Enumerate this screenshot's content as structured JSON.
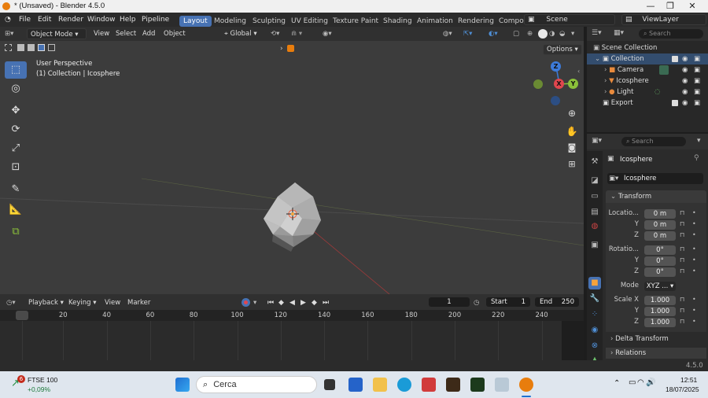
{
  "window": {
    "title": "* (Unsaved) - Blender 4.5.0"
  },
  "menu": [
    "File",
    "Edit",
    "Render",
    "Window",
    "Help",
    "Pipeline"
  ],
  "workspaces": [
    "Layout",
    "Modeling",
    "Sculpting",
    "UV Editing",
    "Texture Paint",
    "Shading",
    "Animation",
    "Rendering",
    "Compo"
  ],
  "active_workspace": "Layout",
  "scene_label": "Scene",
  "viewlayer_label": "ViewLayer",
  "viewport_header": {
    "mode": "Object Mode",
    "view": "View",
    "select": "Select",
    "add": "Add",
    "object": "Object",
    "orientation": "Global",
    "options": "Options"
  },
  "viewport_overlay": {
    "line1": "User Perspective",
    "line2": "(1) Collection | Icosphere"
  },
  "gizmo": {
    "x": "X",
    "y": "Y",
    "z": "Z"
  },
  "outliner": {
    "search_placeholder": "Search",
    "rows": [
      "Scene Collection",
      "Collection",
      "Camera",
      "Icosphere",
      "Light",
      "Export"
    ]
  },
  "properties": {
    "search_placeholder": "Search",
    "object_name": "Icosphere",
    "data_name": "Icosphere",
    "transform_label": "Transform",
    "location_label": "Locatio...",
    "loc": [
      "0 m",
      "0 m",
      "0 m"
    ],
    "rotation_label": "Rotatio...",
    "rot": [
      "0°",
      "0°",
      "0°"
    ],
    "axis_y": "Y",
    "axis_z": "Z",
    "mode_label": "Mode",
    "mode_value": "XYZ ...",
    "scale_label": "Scale X",
    "scale": [
      "1.000",
      "1.000",
      "1.000"
    ],
    "delta_label": "Delta Transform",
    "relations_label": "Relations"
  },
  "timeline": {
    "playback": "Playback",
    "keying": "Keying",
    "view": "View",
    "marker": "Marker",
    "current_frame": "1",
    "start_label": "Start",
    "start": "1",
    "end_label": "End",
    "end": "250",
    "ticks": [
      "1",
      "20",
      "40",
      "60",
      "80",
      "100",
      "120",
      "140",
      "160",
      "180",
      "200",
      "220",
      "240"
    ]
  },
  "status": {
    "version": "4.5.0"
  },
  "taskbar": {
    "ticker": "FTSE 100",
    "ticker_change": "+0,09%",
    "badge": "6",
    "search_placeholder": "Cerca",
    "time": "12:51",
    "date": "18/07/2025"
  },
  "colors": {
    "accent": "#4772b3",
    "viewport": "#3c3c3c",
    "x_axis": "#e0464e",
    "y_axis": "#8bc13a",
    "z_axis": "#3d7bd9"
  }
}
